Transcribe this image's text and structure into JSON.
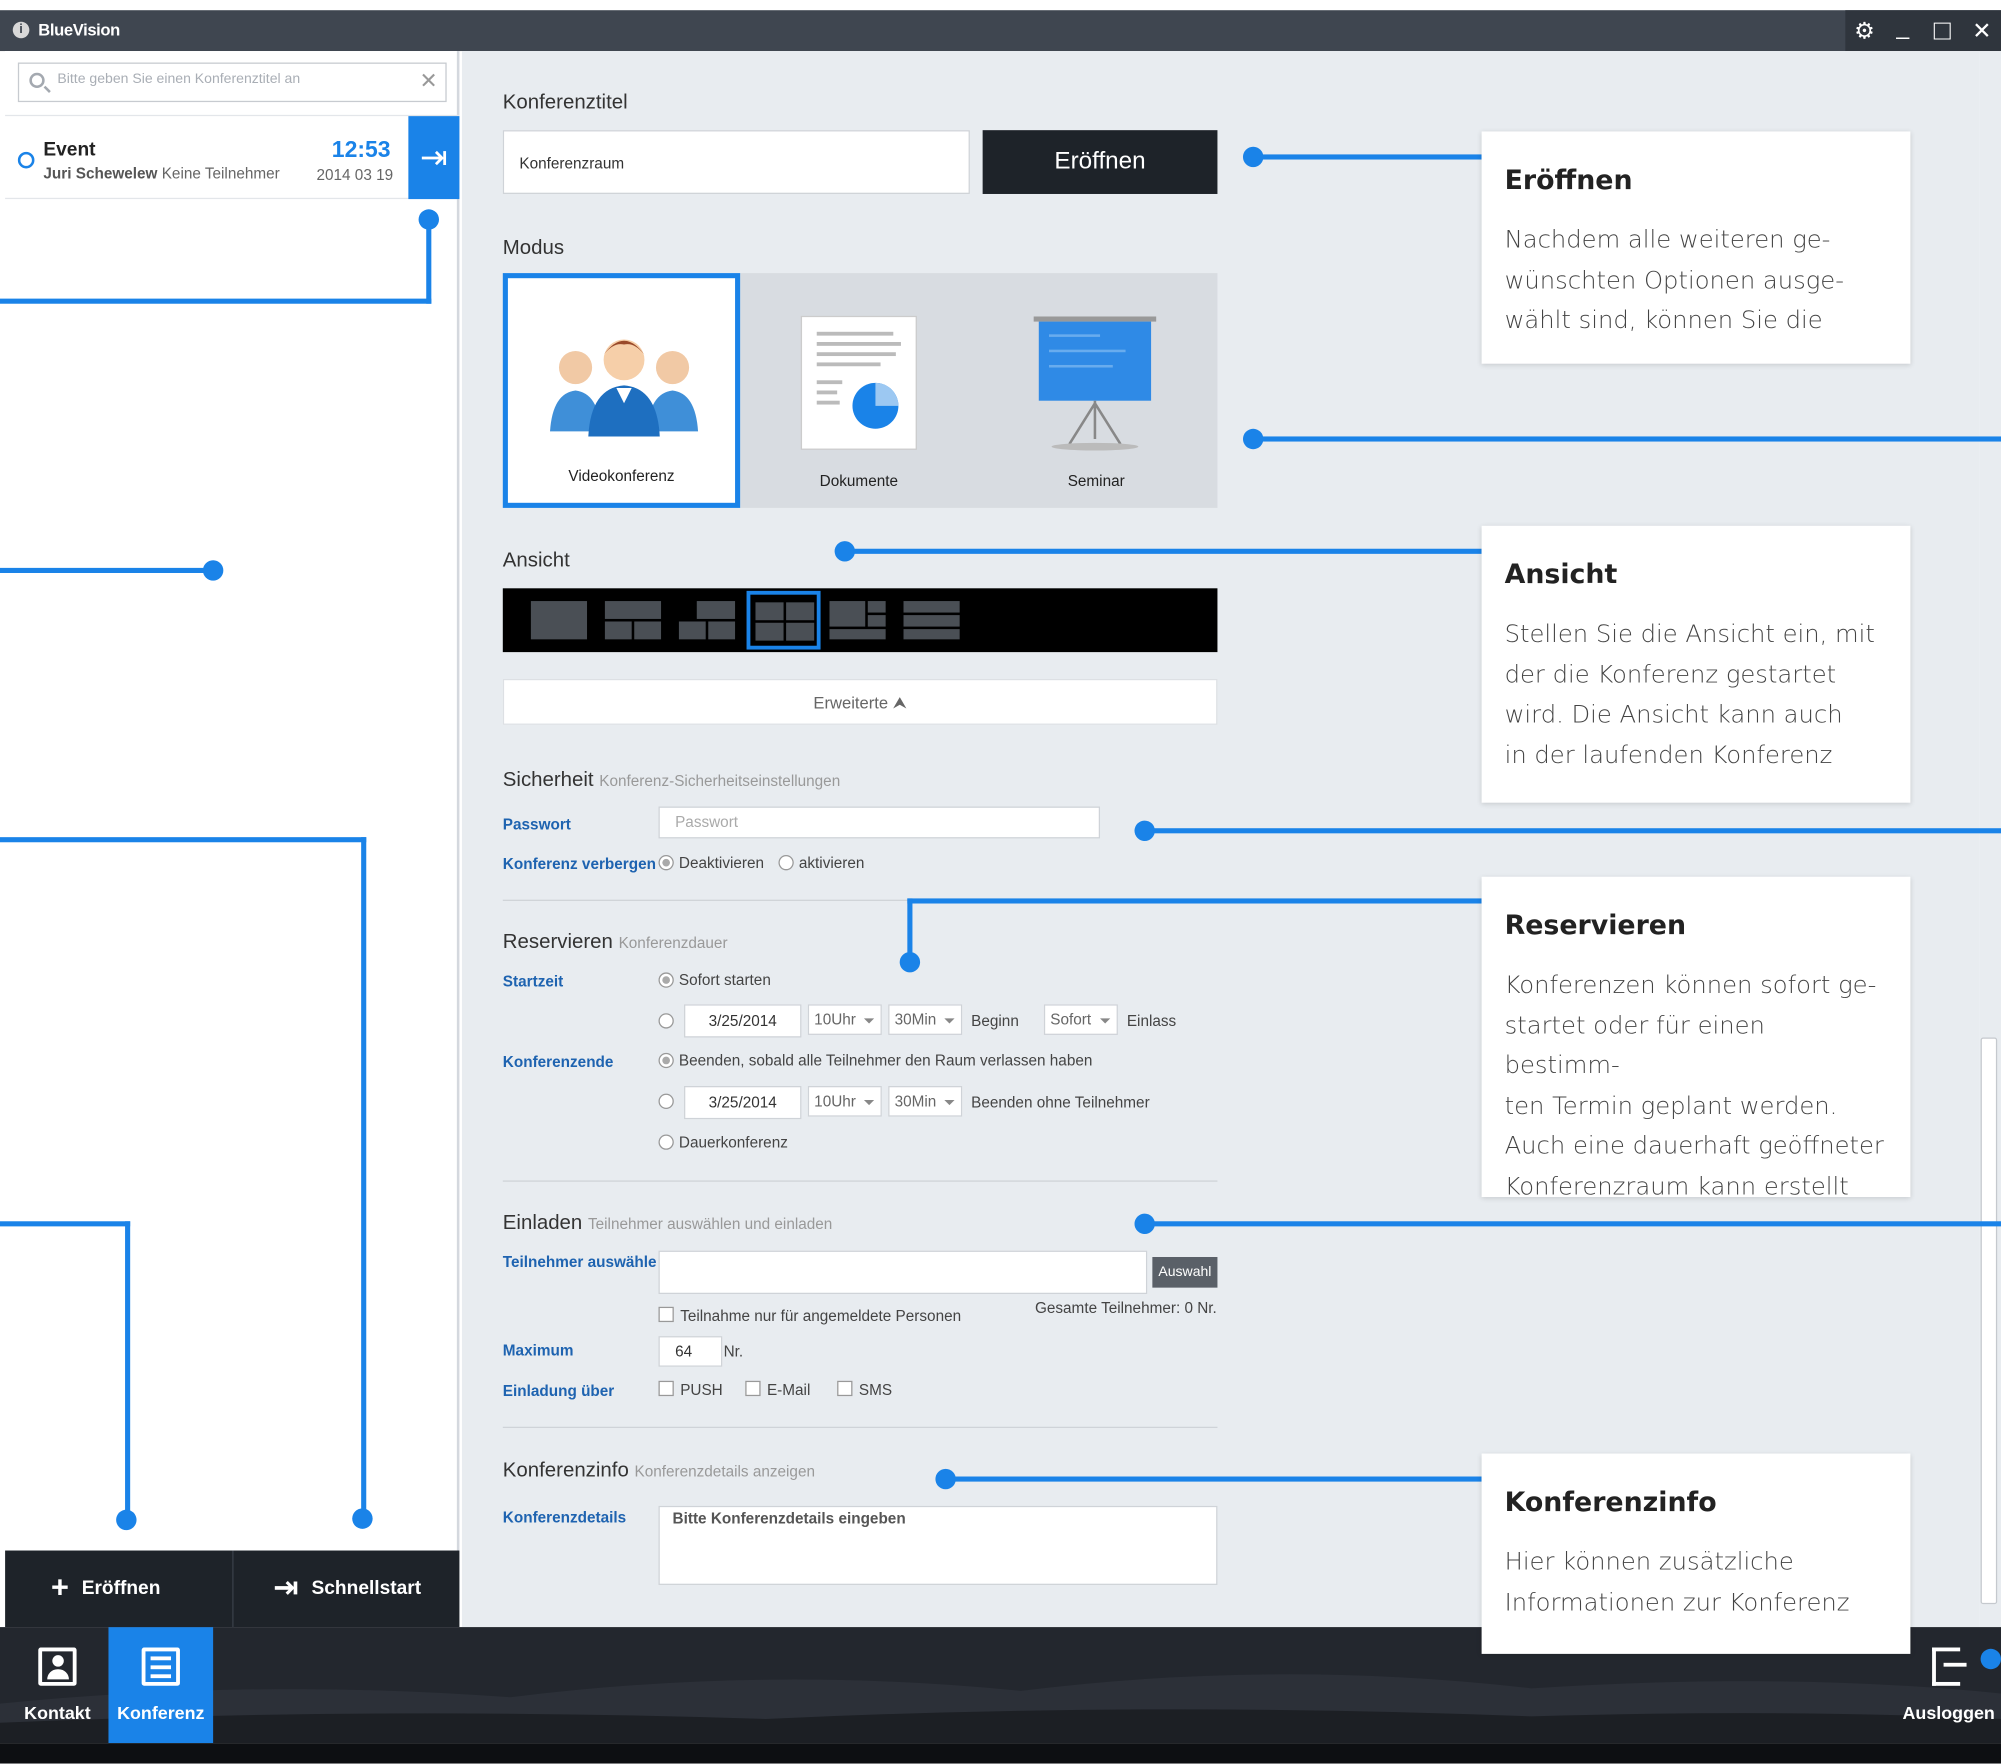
{
  "app": {
    "title": "BlueVision",
    "logo_glyph": "i"
  },
  "window_controls": {
    "settings": "⚙",
    "minimize": "_",
    "maximize": "□",
    "close": "✕"
  },
  "left": {
    "search_placeholder": "Bitte geben Sie einen Konferenztitel an",
    "clear_glyph": "✕",
    "event": {
      "name": "Event",
      "owner": "Juri Schewelew",
      "participants": "Keine Teilnehmer",
      "time": "12:53",
      "date": "2014 03 19",
      "enter_glyph": "⇥"
    },
    "buttons": {
      "open": "Eröffnen",
      "quickstart": "Schnellstart",
      "open_glyph": "+",
      "quick_glyph": "⇥"
    }
  },
  "form": {
    "title_label": "Konferenztitel",
    "title_value": "Konferenzraum",
    "open_button": "Eröffnen",
    "mode_label": "Modus",
    "modes": [
      "Videokonferenz",
      "Dokumente",
      "Seminar"
    ],
    "selected_mode": "Videokonferenz",
    "view_label": "Ansicht",
    "views": [
      "view-1",
      "view-2",
      "view-3",
      "view-4",
      "view-5",
      "view-6"
    ],
    "selected_view": 4,
    "advanced": "Erweiterte ⮝",
    "security": {
      "title": "Sicherheit",
      "sub": "Konferenz-Sicherheitseinstellungen",
      "password_label": "Passwort",
      "password_placeholder": "Passwort",
      "hide_label": "Konferenz verbergen",
      "opt_off": "Deaktivieren",
      "opt_on": "aktivieren"
    },
    "reserve": {
      "title": "Reservieren",
      "sub": "Konferenzdauer",
      "start_label": "Startzeit",
      "start_now": "Sofort starten",
      "date1": "3/25/2014",
      "hour1": "10Uhr",
      "min1": "30Min",
      "begin": "Beginn",
      "admit": "Sofort",
      "admit_label": "Einlass",
      "end_label": "Konferenzende",
      "end_all_left": "Beenden, sobald alle Teilnehmer den Raum verlassen haben",
      "date2": "3/25/2014",
      "hour2": "10Uhr",
      "min2": "30Min",
      "end_no_participants": "Beenden ohne Teilnehmer",
      "permanent": "Dauerkonferenz"
    },
    "invite": {
      "title": "Einladen",
      "sub": "Teilnehmer auswählen und einladen",
      "select_label": "Teilnehmer auswähle",
      "select_button": "Auswahl",
      "only_registered": "Teilnahme nur für angemeldete Personen",
      "total": "Gesamte Teilnehmer: 0 Nr.",
      "max_label": "Maximum",
      "max_value": "64",
      "max_unit": "Nr.",
      "via_label": "Einladung über",
      "via": [
        "PUSH",
        "E-Mail",
        "SMS"
      ]
    },
    "info": {
      "title": "Konferenzinfo",
      "sub": "Konferenzdetails anzeigen",
      "details_label": "Konferenzdetails",
      "details_placeholder": "Bitte Konferenzdetails eingeben"
    }
  },
  "callouts": {
    "open": {
      "title": "Eröffnen",
      "text": [
        "Nachdem alle weiteren ge-",
        "wünschten Optionen ausge-",
        "wählt sind, können Sie die"
      ]
    },
    "view": {
      "title": "Ansicht",
      "text": [
        "Stellen Sie die Ansicht ein, mit",
        "der die Konferenz gestartet",
        "wird. Die Ansicht kann auch",
        "in der laufenden Konferenz"
      ]
    },
    "reserve": {
      "title": "Reservieren",
      "text": [
        "Konferenzen können sofort ge-",
        "startet oder für einen bestimm-",
        "ten Termin geplant werden.",
        "Auch eine dauerhaft geöffneter",
        "Konferenzraum kann erstellt"
      ]
    },
    "info": {
      "title": "Konferenzinfo",
      "text": [
        "Hier können zusätzliche",
        "Informationen zur Konferenz"
      ]
    }
  },
  "bottom": {
    "contact": "Kontakt",
    "conference": "Konferenz",
    "logout": "Ausloggen"
  },
  "colors": {
    "accent": "#1a83e8",
    "titlebar": "#3f4650",
    "dark": "#1e2329",
    "link_label": "#1e63b0"
  }
}
